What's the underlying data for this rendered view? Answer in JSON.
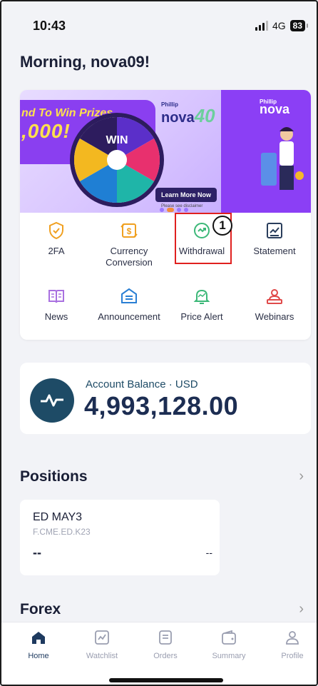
{
  "status_bar": {
    "time": "10:43",
    "network": "4G",
    "battery": "83"
  },
  "greeting": "Morning, nova09!",
  "banner": {
    "promo_line1": "nd To Win Prizes",
    "promo_line2": ",000!",
    "brand_small": "Phillip",
    "brand_left": "nova",
    "brand_num": "40",
    "brand_right": "nova",
    "wheel_center": "WIN",
    "button_label": "Learn More Now",
    "disclaimer": "Please see disclaimer"
  },
  "quick_actions": [
    {
      "label": "2FA",
      "icon": "shield-check-icon",
      "color": "#f0a020"
    },
    {
      "label": "Currency Conversion",
      "icon": "currency-exchange-icon",
      "color": "#f0a020"
    },
    {
      "label": "Withdrawal",
      "icon": "withdrawal-icon",
      "color": "#3cb878"
    },
    {
      "label": "Statement",
      "icon": "statement-chart-icon",
      "color": "#2a3e5c"
    },
    {
      "label": "News",
      "icon": "news-book-icon",
      "color": "#a970e0"
    },
    {
      "label": "Announcement",
      "icon": "announcement-icon",
      "color": "#2a7fd4"
    },
    {
      "label": "Price Alert",
      "icon": "price-alert-bell-icon",
      "color": "#3cb878"
    },
    {
      "label": "Webinars",
      "icon": "webinar-presenter-icon",
      "color": "#e04a4a"
    }
  ],
  "annotation_step": "1",
  "account": {
    "label": "Account Balance · USD",
    "balance": "4,993,128.00"
  },
  "positions": {
    "title": "Positions",
    "card": {
      "name": "ED MAY3",
      "code": "F.CME.ED.K23",
      "left_value": "--",
      "right_value": "--"
    }
  },
  "forex": {
    "title": "Forex"
  },
  "bottom_nav": [
    {
      "label": "Home",
      "icon": "home-icon",
      "active": true
    },
    {
      "label": "Watchlist",
      "icon": "watchlist-chart-icon",
      "active": false
    },
    {
      "label": "Orders",
      "icon": "orders-document-icon",
      "active": false
    },
    {
      "label": "Summary",
      "icon": "wallet-icon",
      "active": false
    },
    {
      "label": "Profile",
      "icon": "profile-person-icon",
      "active": false
    }
  ],
  "colors": {
    "accent_dark": "#1e4b66",
    "highlight_red": "#e0201f",
    "banner_purple": "#8b3ff5"
  }
}
